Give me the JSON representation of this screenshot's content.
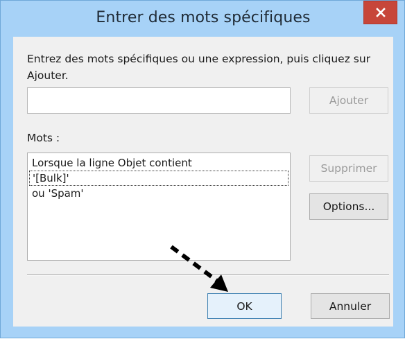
{
  "dialog": {
    "title": "Entrer des mots spécifiques",
    "close_icon": "close-icon",
    "prompt": "Entrez des mots spécifiques ou une expression, puis cliquez sur Ajouter.",
    "word_input": {
      "value": "",
      "placeholder": ""
    },
    "add_label": "Ajouter",
    "words_label": "Mots :",
    "list_lines": [
      "Lorsque la ligne Objet contient",
      "'[Bulk]'",
      "ou 'Spam'"
    ],
    "remove_label": "Supprimer",
    "options_label": "Options...",
    "ok_label": "OK",
    "cancel_label": "Annuler",
    "annotation": "dashed-arrow pointing to OK button"
  },
  "colors": {
    "frame": "#a7d2f7",
    "close_button": "#c7463a",
    "client": "#f0f0f0",
    "default_button_border": "#3c7fb1"
  }
}
